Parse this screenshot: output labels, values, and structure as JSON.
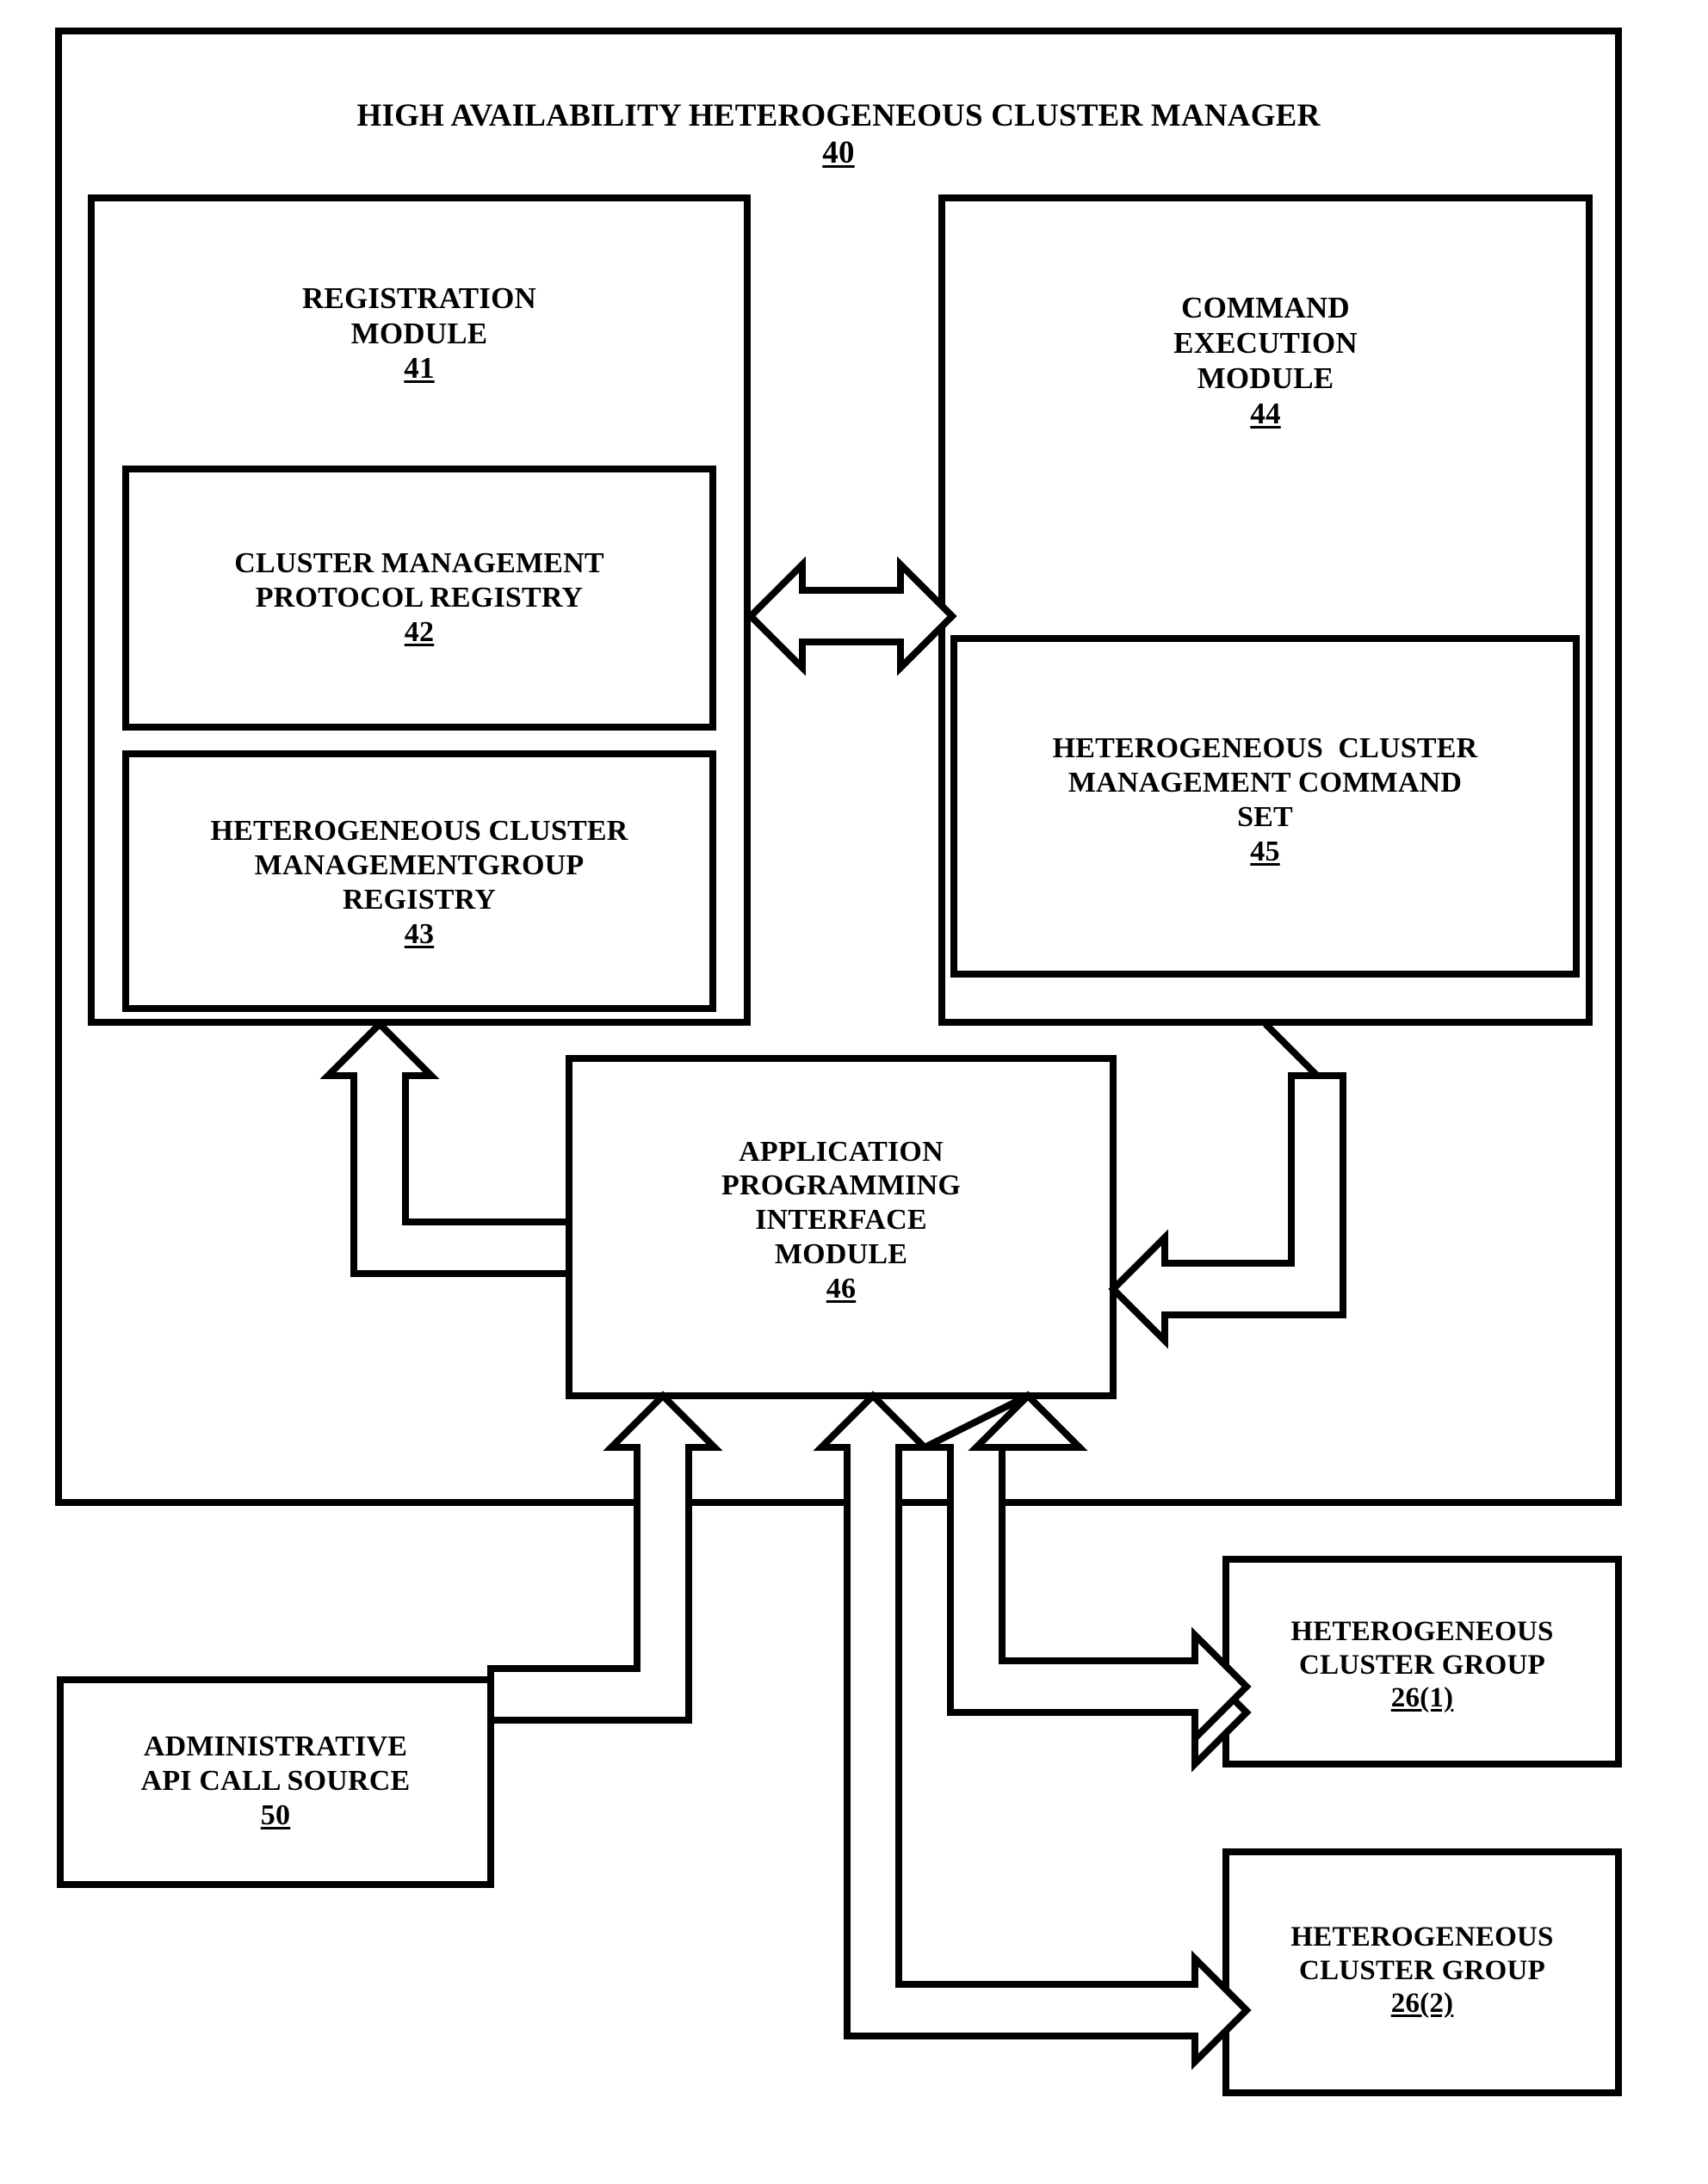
{
  "figure": {
    "type": "patent-block-diagram",
    "background_color": "#ffffff",
    "line_color": "#000000"
  },
  "outer_frame": {
    "title": "HIGH AVAILABILITY HETEROGENEOUS CLUSTER MANAGER",
    "ref": "40"
  },
  "blocks": {
    "registration_module": {
      "lines": [
        "REGISTRATION",
        "MODULE"
      ],
      "ref": "41"
    },
    "protocol_registry": {
      "lines": [
        "CLUSTER MANAGEMENT",
        "PROTOCOL REGISTRY"
      ],
      "ref": "42"
    },
    "group_registry": {
      "lines": [
        "HETEROGENEOUS CLUSTER",
        "MANAGEMENTGROUP",
        "REGISTRY"
      ],
      "ref": "43"
    },
    "command_execution_module": {
      "lines": [
        "COMMAND",
        "EXECUTION",
        "MODULE"
      ],
      "ref": "44"
    },
    "command_set": {
      "lines": [
        "HETEROGENEOUS  CLUSTER",
        "MANAGEMENT COMMAND",
        "SET"
      ],
      "ref": "45"
    },
    "api_module": {
      "lines": [
        "APPLICATION",
        "PROGRAMMING",
        "INTERFACE",
        "MODULE"
      ],
      "ref": "46"
    },
    "admin_api_call_source": {
      "lines": [
        "ADMINISTRATIVE",
        "API CALL SOURCE"
      ],
      "ref": "50"
    },
    "cluster_group_1": {
      "lines": [
        "HETEROGENEOUS",
        "CLUSTER GROUP"
      ],
      "ref": "26(1)"
    },
    "cluster_group_2": {
      "lines": [
        "HETEROGENEOUS",
        "CLUSTER GROUP"
      ],
      "ref": "26(2)"
    }
  },
  "connectors": [
    {
      "name": "registration-to-command-bidirectional",
      "style": "hollow-double-headed-arrow",
      "orientation": "horizontal"
    },
    {
      "name": "api-to-registration",
      "style": "hollow-block-arrow",
      "orientation": "up-left-elbow"
    },
    {
      "name": "command-to-api-bidirectional",
      "style": "hollow-block-arrow",
      "orientation": "up-and-left-elbow"
    },
    {
      "name": "admin-source-to-api",
      "style": "hollow-block-arrow",
      "orientation": "right-up-elbow"
    },
    {
      "name": "api-to-cluster-group-1",
      "style": "hollow-block-arrow",
      "orientation": "down-right-elbow"
    },
    {
      "name": "api-to-cluster-group-2",
      "style": "hollow-block-arrow",
      "orientation": "down-right-elbow"
    }
  ]
}
